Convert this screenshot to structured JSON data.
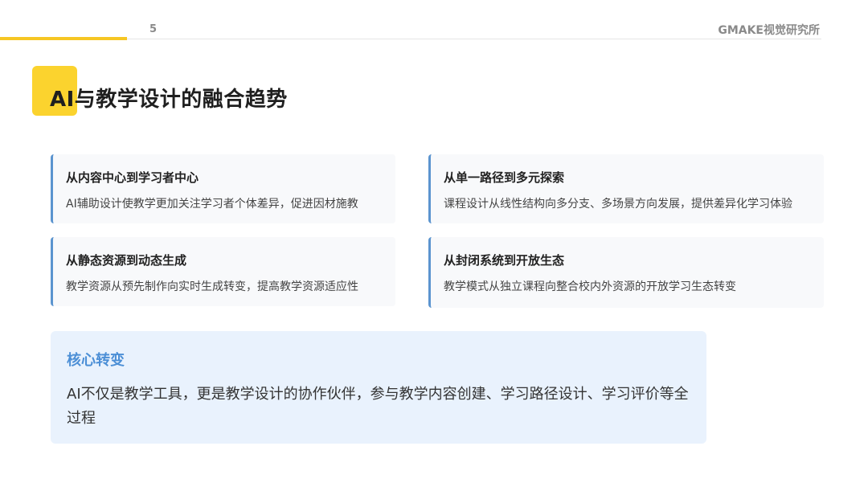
{
  "header": {
    "page_number": "5",
    "brand": "GMAKE视觉研究所"
  },
  "title": "AI与教学设计的融合趋势",
  "cards": [
    {
      "title": "从内容中心到学习者中心",
      "description": "AI辅助设计使教学更加关注学习者个体差异，促进因材施教"
    },
    {
      "title": "从单一路径到多元探索",
      "description": "课程设计从线性结构向多分支、多场景方向发展，提供差异化学习体验"
    },
    {
      "title": "从静态资源到动态生成",
      "description": "教学资源从预先制作向实时生成转变，提高教学资源适应性"
    },
    {
      "title": "从封闭系统到开放生态",
      "description": "教学模式从独立课程向整合校内外资源的开放学习生态转变"
    }
  ],
  "core": {
    "title": "核心转变",
    "text": "AI不仅是教学工具，更是教学设计的协作伙伴，参与教学内容创建、学习路径设计、学习评价等全过程"
  },
  "colors": {
    "accent_yellow": "#fbd32e",
    "card_border_blue": "#5b94cf",
    "core_title_blue": "#4c8fd6",
    "core_bg": "#e9f2fd"
  }
}
